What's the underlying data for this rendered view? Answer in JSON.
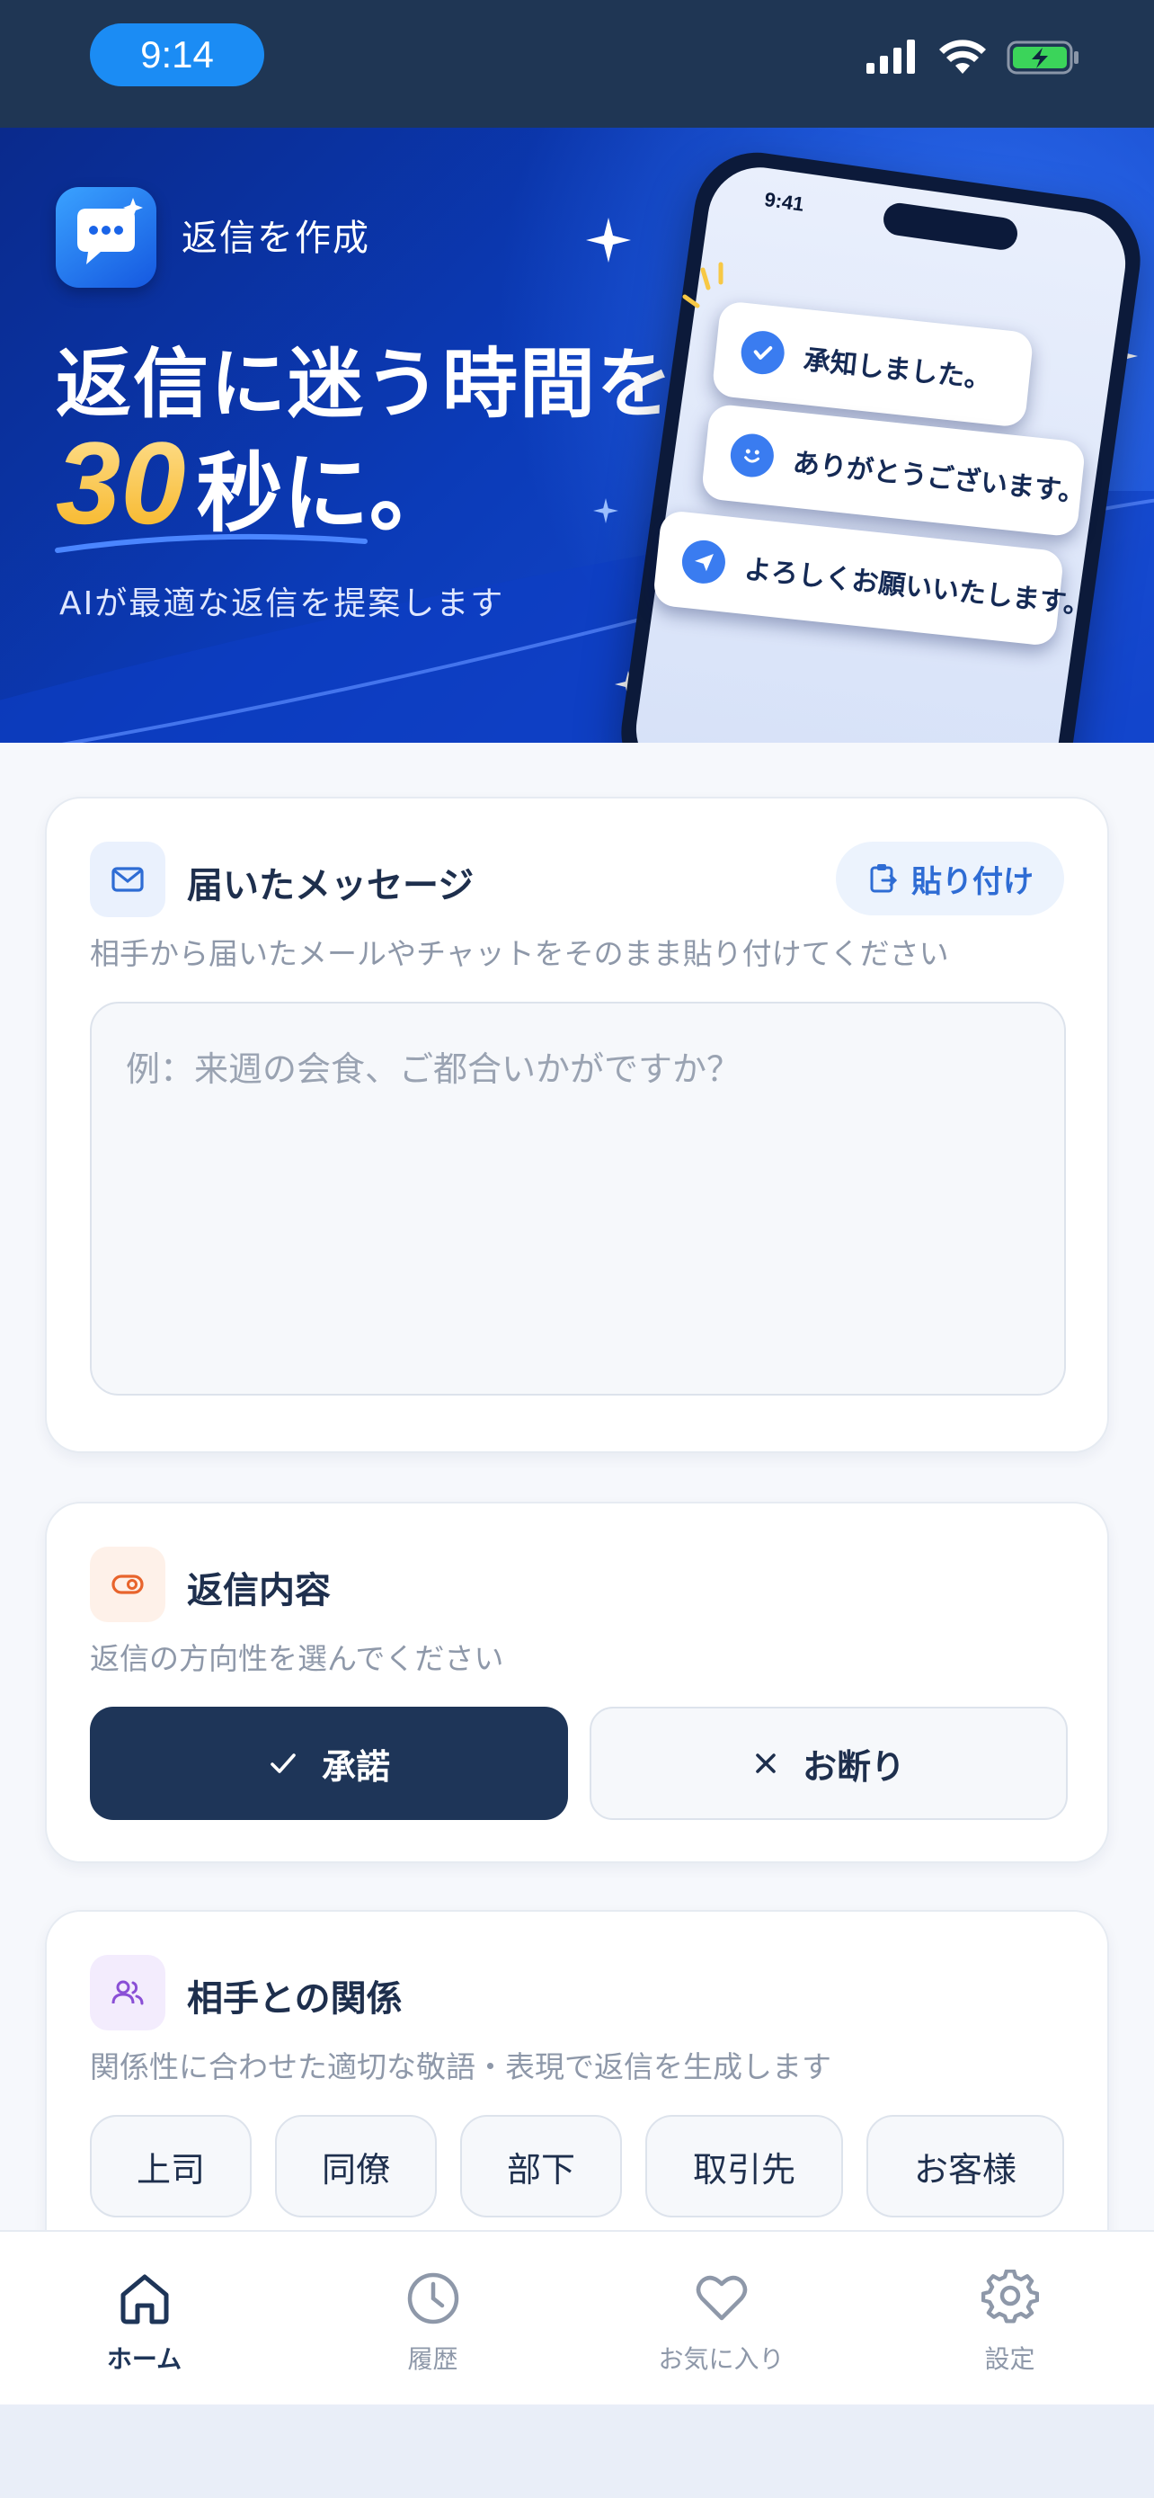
{
  "status_bar": {
    "time": "9:14"
  },
  "hero": {
    "app_label": "返信を作成",
    "headline_line1": "返信に迷う時間を、",
    "headline_number": "30",
    "headline_suffix": "秒に。",
    "subtitle": "AIが最適な返信を提案します",
    "phone_time": "9:41",
    "bubbles": [
      "承知しました。",
      "ありがとうございます。",
      "よろしくお願いいたします。"
    ]
  },
  "message_card": {
    "title": "届いたメッセージ",
    "paste_label": "貼り付け",
    "description": "相手から届いたメールやチャットをそのまま貼り付けてください",
    "placeholder": "例：来週の会食、ご都合いかがですか？"
  },
  "reply_card": {
    "title": "返信内容",
    "description": "返信の方向性を選んでください",
    "options": [
      {
        "label": "承諾",
        "selected": true,
        "icon": "check-icon"
      },
      {
        "label": "お断り",
        "selected": false,
        "icon": "x-icon"
      }
    ]
  },
  "relation_card": {
    "title": "相手との関係",
    "description": "関係性に合わせた適切な敬語・表現で返信を生成します",
    "chips": [
      "上司",
      "同僚",
      "部下",
      "取引先",
      "お客様"
    ]
  },
  "tabbar": {
    "tabs": [
      {
        "label": "ホーム",
        "icon": "home-icon",
        "active": true
      },
      {
        "label": "履歴",
        "icon": "clock-icon",
        "active": false
      },
      {
        "label": "お気に入り",
        "icon": "heart-icon",
        "active": false
      },
      {
        "label": "設定",
        "icon": "gear-icon",
        "active": false
      }
    ]
  },
  "colors": {
    "primary_dark": "#1e3558",
    "accent_blue": "#2e6cd4",
    "hero_blue": "#0b3bb8",
    "accent_orange": "#e8642c",
    "accent_purple": "#8a4fd6"
  }
}
